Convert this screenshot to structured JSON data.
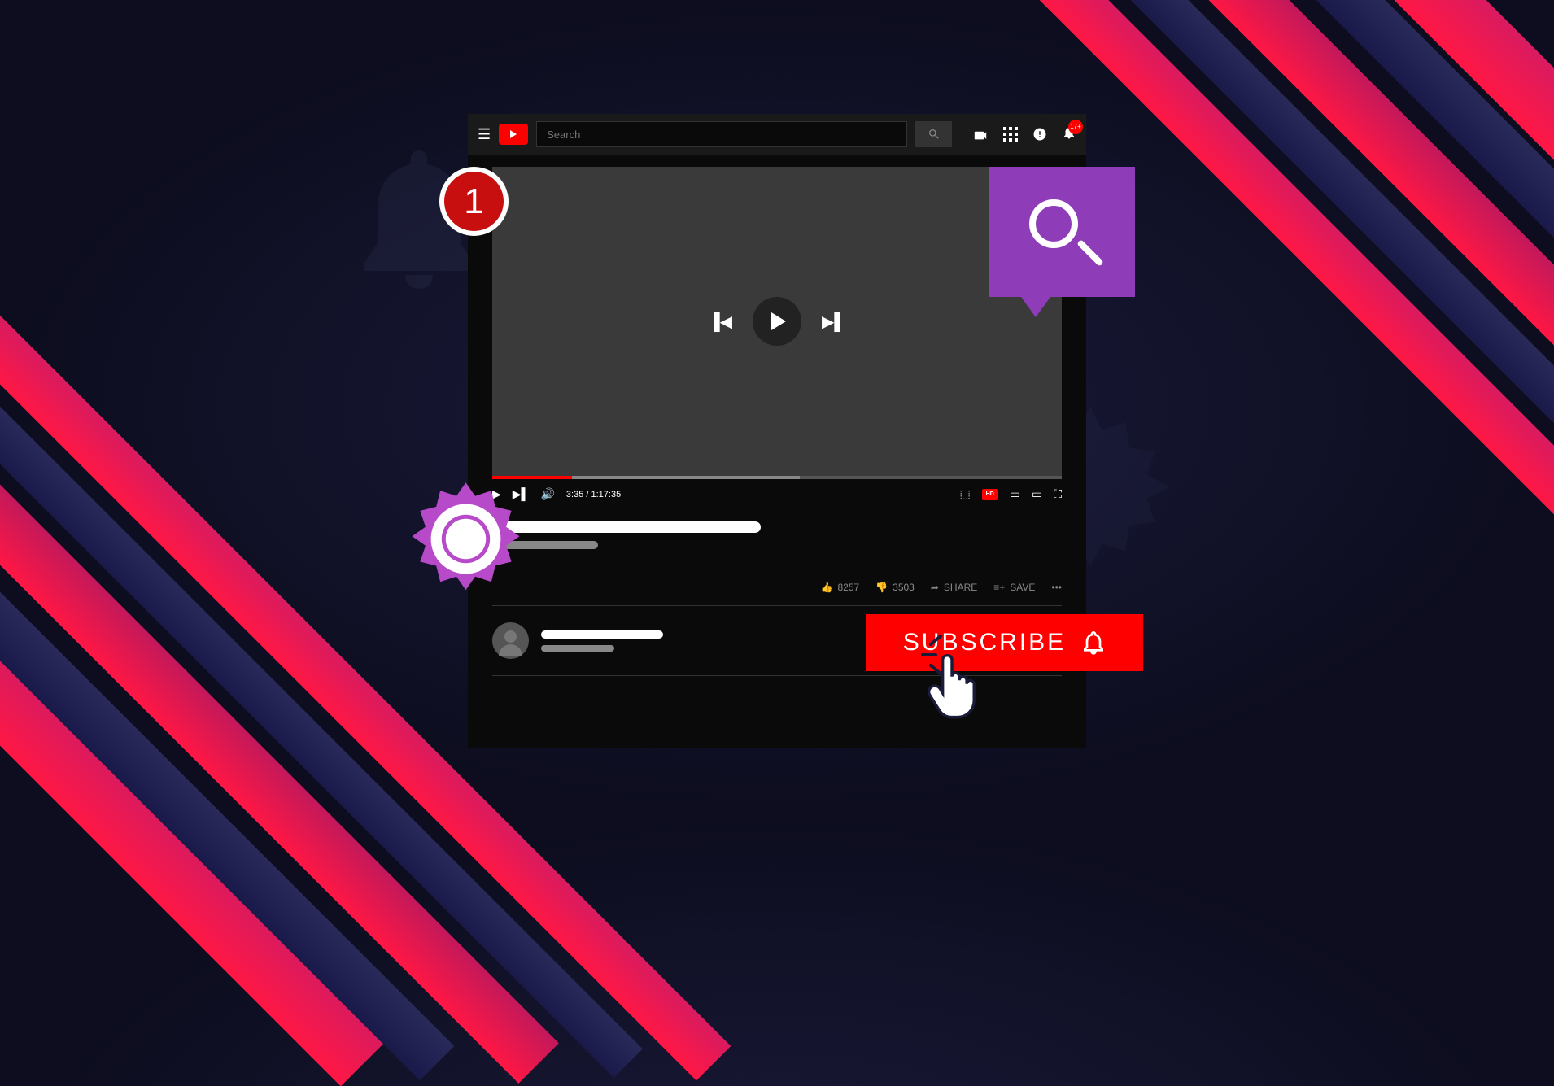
{
  "topbar": {
    "search_placeholder": "Search",
    "notif_badge": "17+"
  },
  "player": {
    "time_current": "3:35",
    "time_total": "1:17:35",
    "time_display": "3:35 / 1:17:35"
  },
  "actions": {
    "likes": "8257",
    "dislikes": "3503",
    "share": "SHARE",
    "save": "SAVE"
  },
  "badges": {
    "notification_count": "1",
    "subscribe": "SUBSCRIBE"
  }
}
